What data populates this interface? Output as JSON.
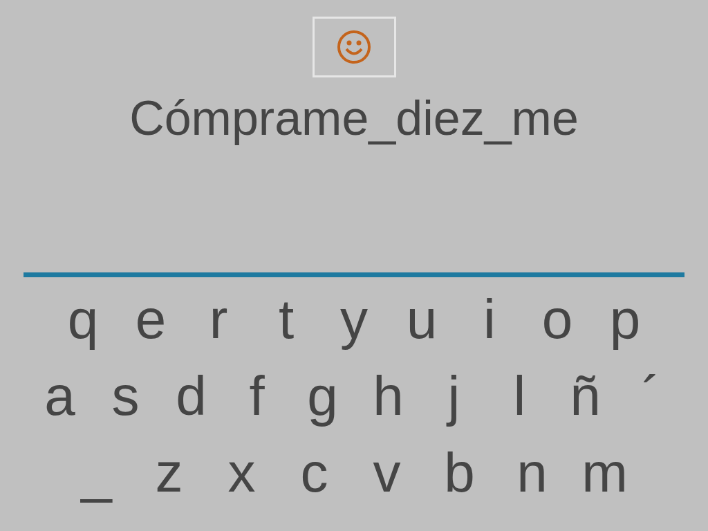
{
  "phrase": "Cómprame_diez_me",
  "keyboard": {
    "rows": [
      [
        "q",
        "e",
        "r",
        "t",
        "y",
        "u",
        "i",
        "o",
        "p"
      ],
      [
        "a",
        "s",
        "d",
        "f",
        "g",
        "h",
        "j",
        "l",
        "ñ",
        "´"
      ],
      [
        "_",
        "z",
        "x",
        "c",
        "v",
        "b",
        "n",
        "m"
      ]
    ]
  }
}
